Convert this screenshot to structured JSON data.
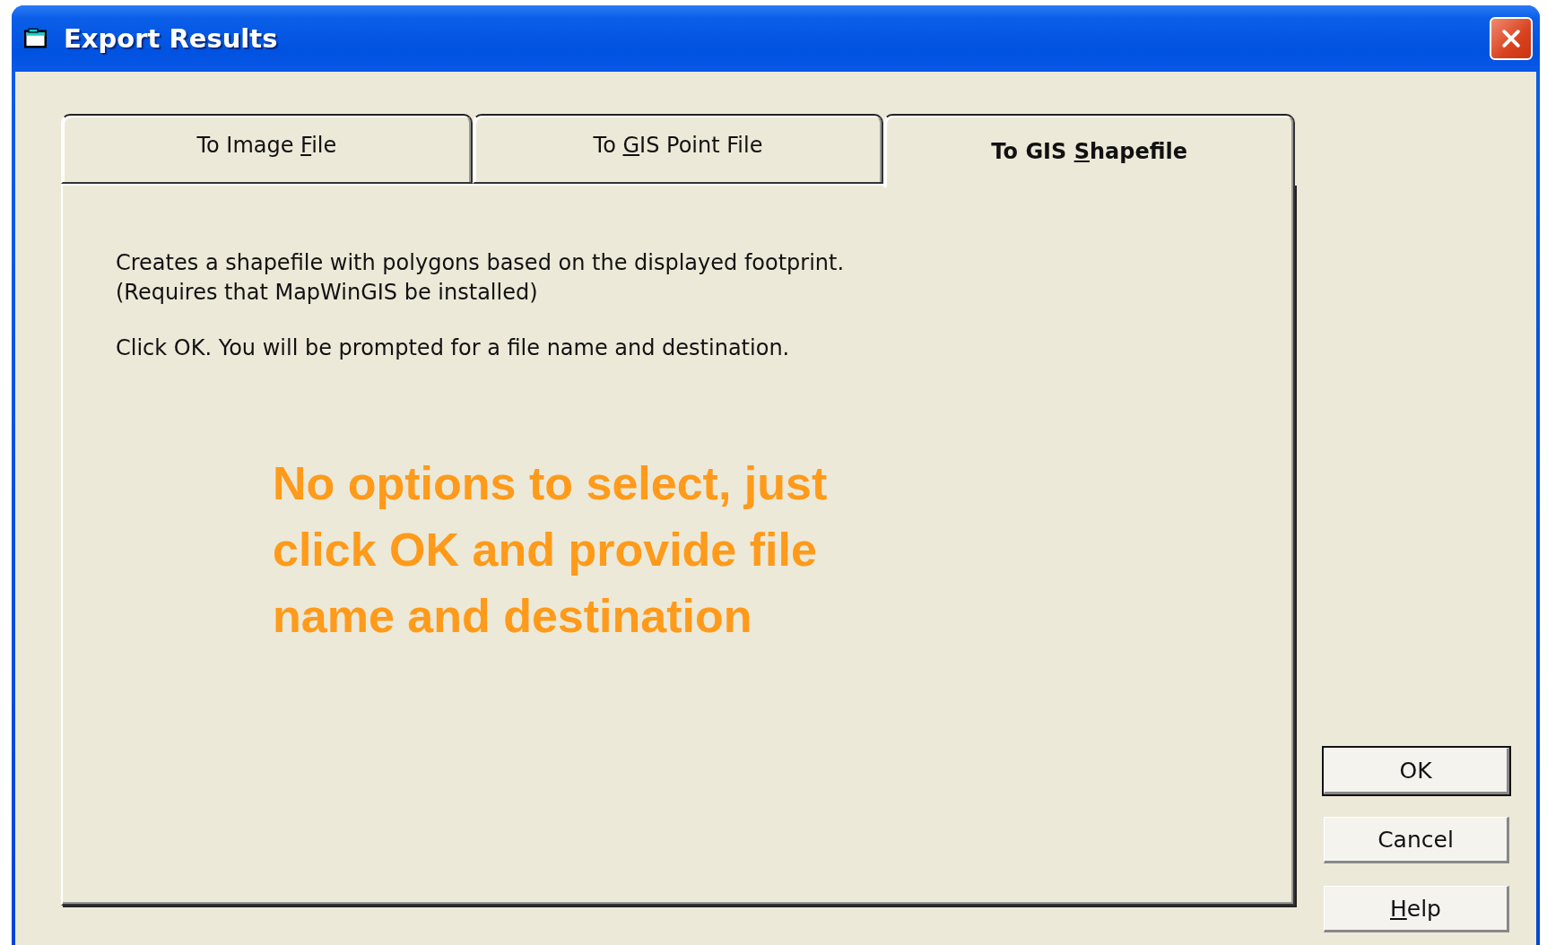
{
  "window": {
    "title": "Export Results"
  },
  "tabs": [
    {
      "label_before": "To Image ",
      "access_key": "F",
      "label_after": "ile",
      "selected": false
    },
    {
      "label_before": "To ",
      "access_key": "G",
      "label_after": "IS Point File",
      "selected": false
    },
    {
      "label_before": "To GIS ",
      "access_key": "S",
      "label_after": "hapefile",
      "selected": true
    }
  ],
  "panel": {
    "description": [
      "Creates a shapefile with polygons based on the displayed footprint.",
      "(Requires that MapWinGIS be installed)"
    ],
    "instruction": "Click OK. You will be prompted for a file name and destination.",
    "annotation": [
      "No options to select, just",
      "click OK and provide file",
      "name and destination"
    ]
  },
  "buttons": [
    {
      "label_before": "OK",
      "default": true
    },
    {
      "label_before": "Cancel",
      "default": false
    },
    {
      "access_key": "H",
      "label_after": "elp",
      "default": false
    }
  ]
}
